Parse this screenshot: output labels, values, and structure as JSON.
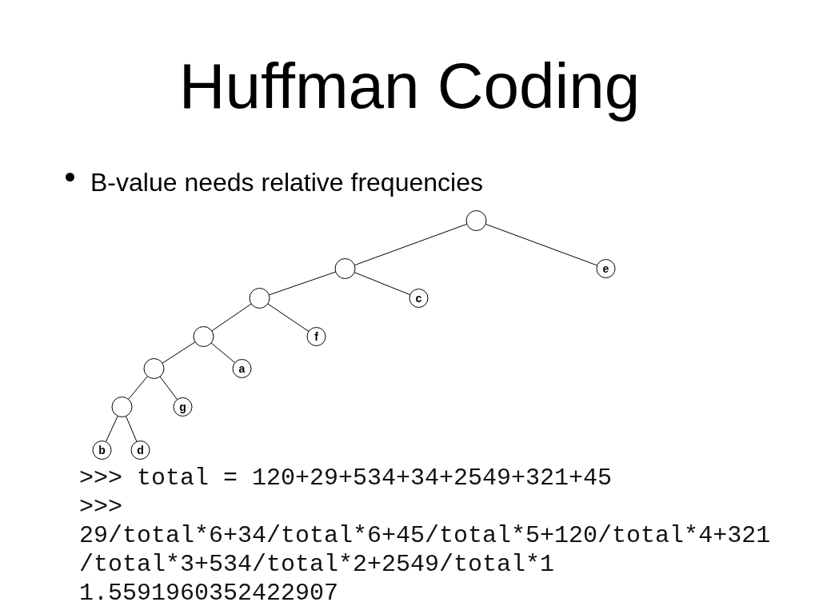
{
  "slide": {
    "title": "Huffman Coding",
    "bullets": [
      {
        "text": "B-value needs relative frequencies"
      }
    ]
  },
  "tree": {
    "root": {
      "children": [
        {
          "children": [
            {
              "children": [
                {
                  "children": [
                    {
                      "children": [
                        {
                          "children": [
                            {
                              "label": "b"
                            },
                            {
                              "label": "d"
                            }
                          ]
                        },
                        {
                          "label": "g"
                        }
                      ]
                    },
                    {
                      "label": "a"
                    }
                  ]
                },
                {
                  "label": "f"
                }
              ]
            },
            {
              "label": "c"
            }
          ]
        },
        {
          "label": "e"
        }
      ]
    }
  },
  "code": {
    "lines": [
      ">>> total = 120+29+534+34+2549+321+45",
      ">>>",
      "29/total*6+34/total*6+45/total*5+120/total*4+321",
      "/total*3+534/total*2+2549/total*1",
      "1.5591960352422907"
    ]
  }
}
